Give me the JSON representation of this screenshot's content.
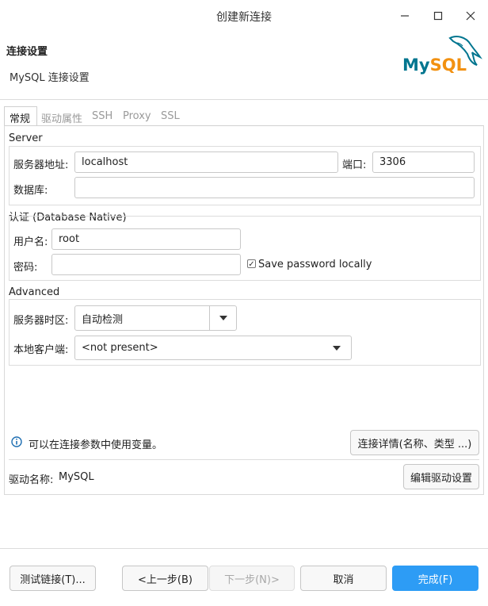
{
  "window": {
    "title": "创建新连接"
  },
  "header": {
    "title": "连接设置",
    "subtitle": "MySQL 连接设置",
    "logo_text": "MySQL"
  },
  "tabs": [
    {
      "label": "常规",
      "active": true
    },
    {
      "label": "驱动属性",
      "active": false
    },
    {
      "label": "SSH",
      "active": false
    },
    {
      "label": "Proxy",
      "active": false
    },
    {
      "label": "SSL",
      "active": false
    }
  ],
  "server": {
    "group_label": "Server",
    "host_label": "服务器地址:",
    "host_value": "localhost",
    "port_label": "端口:",
    "port_value": "3306",
    "db_label": "数据库:",
    "db_value": ""
  },
  "auth": {
    "group_label": "认证 (Database Native)",
    "user_label": "用户名:",
    "user_value": "root",
    "password_label": "密码:",
    "password_value": "",
    "save_password_label": "Save password locally",
    "save_password_checked": true
  },
  "advanced": {
    "group_label": "Advanced",
    "timezone_label": "服务器时区:",
    "timezone_value": "自动检测",
    "client_label": "本地客户端:",
    "client_value": "<not present>"
  },
  "info": {
    "text": "可以在连接参数中使用变量。",
    "details_button": "连接详情(名称、类型 ...)"
  },
  "driver": {
    "label": "驱动名称:",
    "value": "MySQL",
    "edit_button": "编辑驱动设置"
  },
  "footer": {
    "test_button": "测试链接(T)...",
    "back_button": "<上一步(B)",
    "next_button": "下一步(N)>",
    "cancel_button": "取消",
    "finish_button": "完成(F)"
  },
  "colors": {
    "accent": "#2d9cf5",
    "mysql_blue": "#00758f",
    "mysql_orange": "#f29111"
  }
}
